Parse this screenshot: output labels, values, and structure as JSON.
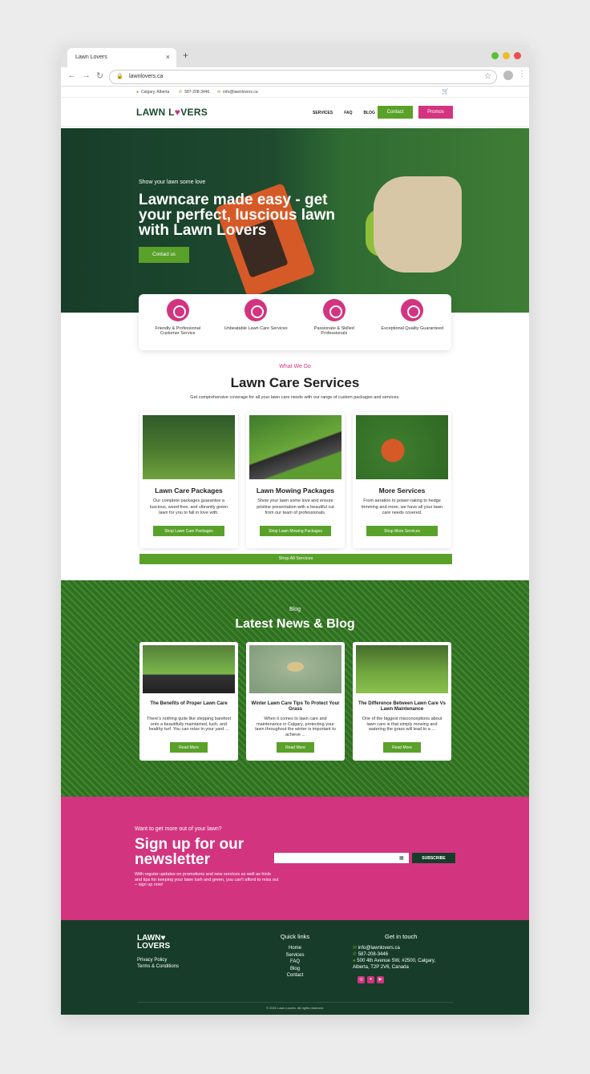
{
  "browser": {
    "tab_title": "Lawn Lovers",
    "tab_close": "×",
    "new_tab": "+",
    "url": "lawnlovers.ca"
  },
  "topbar": {
    "location": "Calgary, Alberta",
    "phone": "587-208-3446",
    "email": "info@lawnlovers.ca"
  },
  "header": {
    "logo_left": "LAWN L",
    "logo_heart": "♥",
    "logo_right": "VERS",
    "nav": [
      "SERVICES",
      "FAQ",
      "BLOG"
    ],
    "contact_label": "Contact",
    "promos_label": "Promos"
  },
  "hero": {
    "subtitle": "Show your lawn some love",
    "title": "Lawncare made easy - get your perfect, luscious lawn with Lawn Lovers",
    "button": "Contact us"
  },
  "features": [
    "Friendly & Professional Customer Service",
    "Unbeatable Lawn Care Services",
    "Passionate & Skilled Professionals",
    "Exceptional Quality Guaranteed"
  ],
  "services": {
    "kicker": "What We Do",
    "title": "Lawn Care Services",
    "subtitle": "Get comprehensive coverage for all your lawn care needs with our range of custom packages and services.",
    "cards": [
      {
        "title": "Lawn Care Packages",
        "desc": "Our complete packages guarantee a luscious, weed-free, and vibrantly green lawn for you to fall in love with.",
        "button": "Shop Lawn Care Packages"
      },
      {
        "title": "Lawn Mowing Packages",
        "desc": "Show your lawn some love and ensure pristine presentation with a beautiful cut from our team of professionals.",
        "button": "Shop Lawn Mowing Packages"
      },
      {
        "title": "More Services",
        "desc": "From aeration to power-raking to hedge trimming and more, we have all your lawn care needs covered.",
        "button": "Shop More Services"
      }
    ],
    "shop_all": "Shop All Services"
  },
  "blog": {
    "kicker": "Blog",
    "title": "Latest News & Blog",
    "posts": [
      {
        "title": "The Benefits of Proper Lawn Care",
        "desc": "There's nothing quite like stepping barefoot onto a beautifully maintained, lush, and healthy turf. You can relax in your yard ...",
        "button": "Read More"
      },
      {
        "title": "Winter Lawn Care Tips To Protect Your Grass",
        "desc": "When it comes to lawn care and maintenance in Calgary, protecting your lawn throughout the winter is important to achieve ...",
        "button": "Read More"
      },
      {
        "title": "The Difference Between Lawn Care Vs Lawn Maintenance",
        "desc": "One of the biggest misconceptions about lawn care is that simply mowing and watering the grass will lead to a ...",
        "button": "Read More"
      }
    ]
  },
  "newsletter": {
    "kicker": "Want to get more out of your lawn?",
    "title": "Sign up for our newsletter",
    "desc": "With regular updates on promotions and new services as well as hints and tips for keeping your lawn lush and green, you can't afford to miss out – sign up now!",
    "placeholder": "",
    "button": "SUBSCRIBE"
  },
  "footer": {
    "logo_line1": "LAWN♥",
    "logo_line2": "LOVERS",
    "left_links": [
      "Privacy Policy",
      "Terms & Conditions"
    ],
    "quick_title": "Quick links",
    "quick_links": [
      "Home",
      "Services",
      "FAQ",
      "Blog",
      "Contact"
    ],
    "touch_title": "Get in touch",
    "email": "info@lawnlovers.ca",
    "phone": "587-208-3446",
    "address": "500 4th Avenue SW, #2500, Calgary, Alberta, T2P 2V6, Canada",
    "copyright": "© 2021 Lawn Lovers. All rights reserved."
  },
  "colors": {
    "green": "#5aa12a",
    "pink": "#d3347f",
    "dark_green": "#173d2a"
  }
}
